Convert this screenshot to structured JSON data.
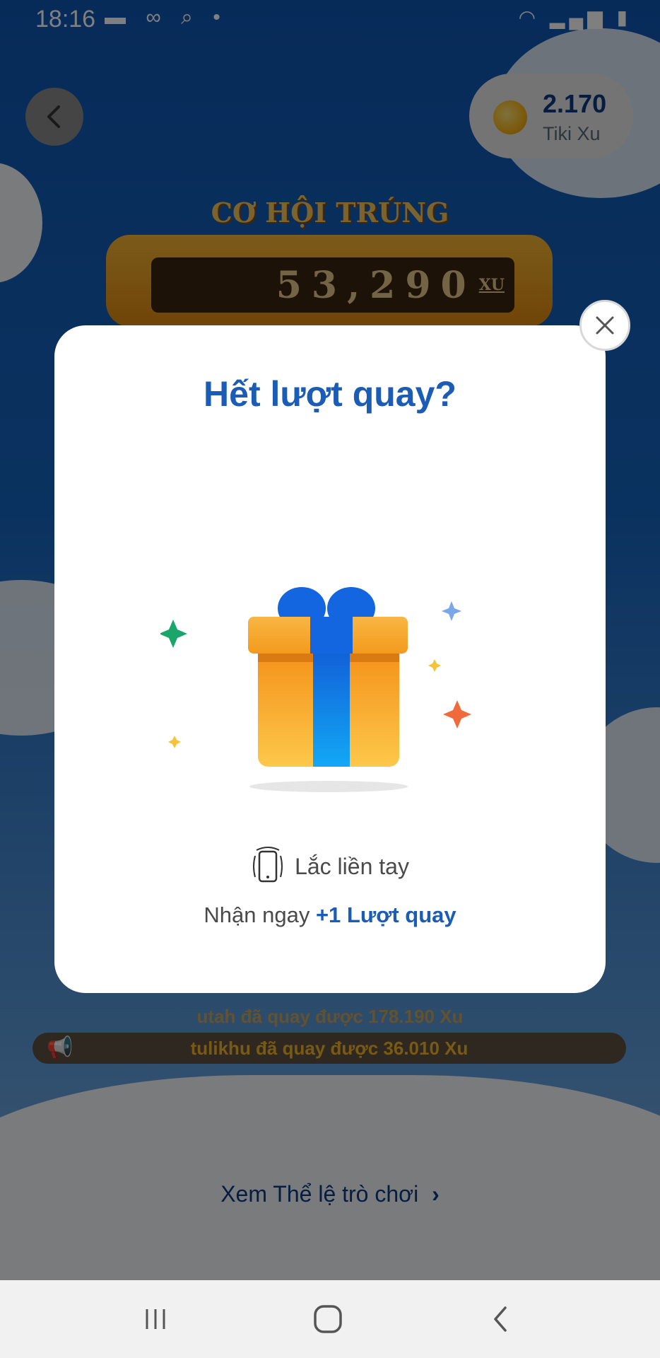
{
  "status_bar": {
    "time": "18:16",
    "left_icons": [
      "message-icon",
      "link-icon",
      "screen-search-icon",
      "dot-icon"
    ],
    "right_icons": [
      "wifi-icon",
      "signal-icon",
      "battery-icon"
    ]
  },
  "header": {
    "back_icon": "chevron-left-icon",
    "xu_amount": "2.170",
    "xu_label": "Tiki Xu"
  },
  "game": {
    "title": "CƠ HỘI TRÚNG",
    "counter_value": "53,290",
    "counter_unit": "XU"
  },
  "tickers": {
    "line1": "utah đã quay được 178.190 Xu",
    "line2": "tulikhu đã quay được 36.010 Xu"
  },
  "rules_link": {
    "label": "Xem Thể lệ trò chơi",
    "icon": "chevron-right-icon"
  },
  "modal": {
    "title": "Hết lượt quay?",
    "shake_label": "Lắc liền tay",
    "reward_prefix": "Nhận ngay",
    "reward_highlight": "+1 Lượt quay",
    "close_icon": "close-icon"
  },
  "nav_bar": {
    "buttons": [
      "recent-apps-icon",
      "home-icon",
      "back-icon"
    ]
  },
  "colors": {
    "accent_blue": "#1b5cb5",
    "gift_orange": "#f7a21b",
    "gift_ribbon": "#1673e6"
  }
}
